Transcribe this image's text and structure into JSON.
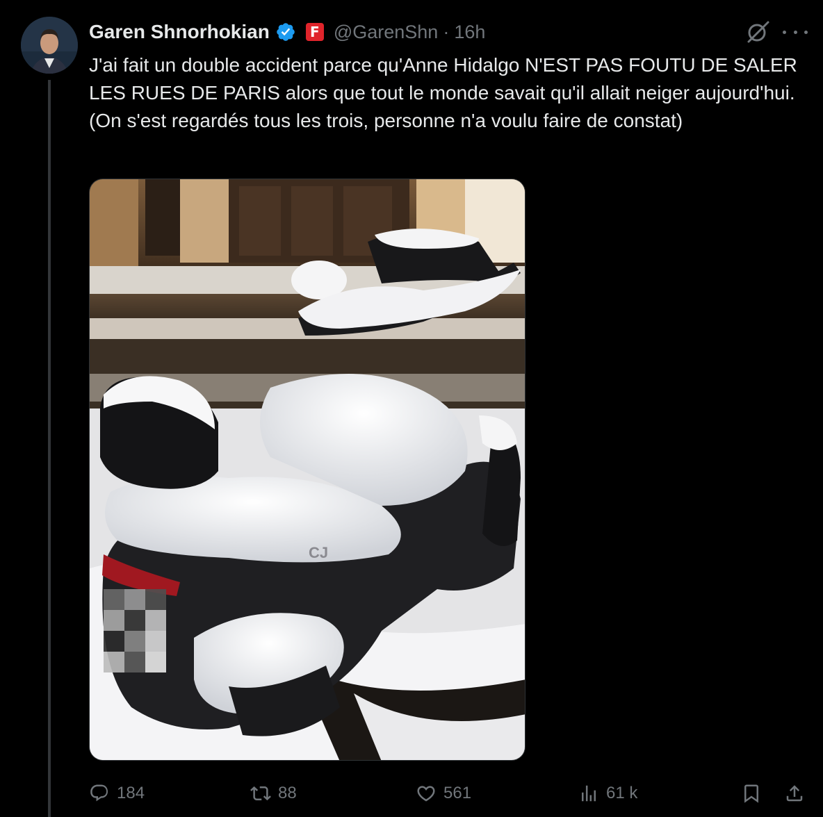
{
  "author": {
    "name": "Garen Shnorhokian",
    "handle": "@GarenShn",
    "separator": "·",
    "time": "16h",
    "affiliation_badge": "F",
    "verified_color": "#1d9bf0",
    "affiliation_color": "#e0242b"
  },
  "tweet": {
    "lines": [
      "J'ai fait un double accident parce qu'Anne Hidalgo N'EST PAS FOUTU DE SALER LES RUES DE PARIS alors que tout le monde savait qu'il allait neiger aujourd'hui.",
      "(On s'est regardés tous les trois, personne n'a voulu faire de constat)"
    ]
  },
  "media": {
    "icon": "snowy-scooter-photo",
    "brand_on_seat": "CJ"
  },
  "actions": {
    "replies": "184",
    "reposts": "88",
    "likes": "561",
    "views": "61 k"
  },
  "icons": {
    "grok": "grok-icon",
    "more": "more-icon",
    "reply": "reply-icon",
    "repost": "repost-icon",
    "like": "heart-icon",
    "views": "views-icon",
    "bookmark": "bookmark-icon",
    "share": "share-icon"
  }
}
